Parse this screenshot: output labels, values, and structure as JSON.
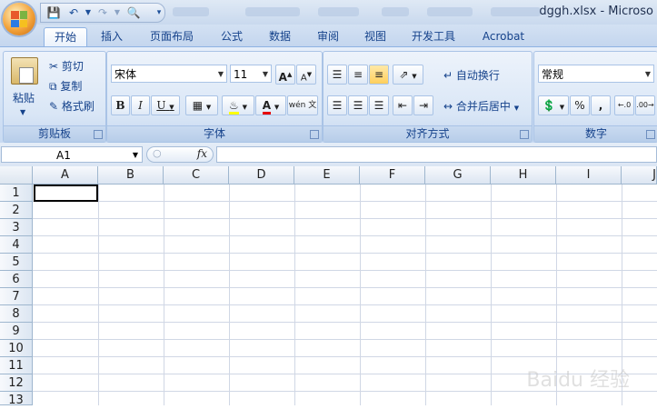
{
  "window": {
    "title": "dggh.xlsx - Microso"
  },
  "qat": {
    "save_icon": "save-icon",
    "undo_icon": "undo-icon",
    "redo_icon": "redo-icon",
    "print_preview_icon": "print-preview-icon"
  },
  "tabs": [
    "开始",
    "插入",
    "页面布局",
    "公式",
    "数据",
    "审阅",
    "视图",
    "开发工具",
    "Acrobat"
  ],
  "active_tab": "开始",
  "clipboard": {
    "paste": "粘贴",
    "cut": "剪切",
    "copy": "复制",
    "format_painter": "格式刷",
    "group_label": "剪贴板"
  },
  "font": {
    "name": "宋体",
    "size": "11",
    "bold": "B",
    "italic": "I",
    "underline": "U",
    "grow": "A",
    "shrink": "A",
    "font_color_letter": "A",
    "phonetic": "wén 文",
    "group_label": "字体"
  },
  "alignment": {
    "wrap_text": "自动换行",
    "merge_center": "合并后居中",
    "group_label": "对齐方式"
  },
  "number": {
    "format": "常规",
    "percent": "%",
    "comma": ",",
    "group_label": "数字"
  },
  "formula_bar": {
    "name_box": "A1",
    "fx": "fx"
  },
  "sheet": {
    "columns": [
      "A",
      "B",
      "C",
      "D",
      "E",
      "F",
      "G",
      "H",
      "I",
      "J"
    ],
    "rows": [
      "1",
      "2",
      "3",
      "4",
      "5",
      "6",
      "7",
      "8",
      "9",
      "10",
      "11",
      "12",
      "13"
    ]
  },
  "watermark": "Baidu 经验",
  "colors": {
    "ribbon": "#d3e2f5",
    "accent_yellow": "#ffd966",
    "font_red": "#e60000"
  }
}
